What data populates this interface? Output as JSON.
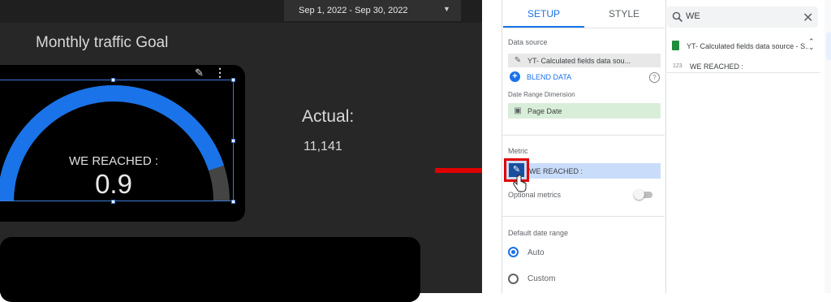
{
  "report": {
    "date_range": "Sep 1, 2022 - Sep 30, 2022",
    "title": "Monthly traffic Goal",
    "gauge": {
      "label": "WE REACHED :",
      "value": "0.9",
      "fill_fraction": 0.9,
      "color": "#1a73e8"
    },
    "actual": {
      "label": "Actual:",
      "value": "11,141"
    }
  },
  "setup_panel": {
    "tabs": [
      {
        "label": "SETUP",
        "active": true
      },
      {
        "label": "STYLE",
        "active": false
      }
    ],
    "data_source_label": "Data source",
    "data_source_value": "YT- Calculated fields data sou...",
    "blend_label": "BLEND DATA",
    "date_dim_label": "Date Range Dimension",
    "date_dim_value": "Page Date",
    "metric_label": "Metric",
    "metric_value": "WE REACHED :",
    "optional_metrics_label": "Optional metrics",
    "optional_metrics_on": false,
    "default_date_label": "Default date range",
    "radio_options": [
      {
        "label": "Auto",
        "selected": true
      },
      {
        "label": "Custom",
        "selected": false
      }
    ]
  },
  "data_panel": {
    "search_value": "WE",
    "source_name": "YT- Calculated fields data source - S...",
    "field_type": "123",
    "field_name": "WE REACHED :"
  },
  "annotation": {
    "arrow_color": "#e00000"
  }
}
